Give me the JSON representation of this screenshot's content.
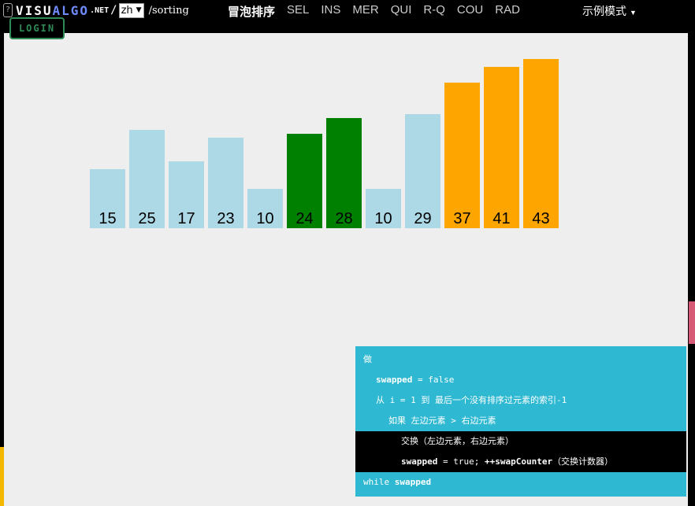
{
  "header": {
    "logo_part1": "VISU",
    "logo_part2": "ALGO",
    "logo_net": ".NET",
    "logo_slash": "/",
    "language": "zh",
    "path": "/sorting",
    "nav": [
      {
        "label": "冒泡排序",
        "active": true
      },
      {
        "label": "SEL"
      },
      {
        "label": "INS"
      },
      {
        "label": "MER"
      },
      {
        "label": "QUI"
      },
      {
        "label": "R-Q"
      },
      {
        "label": "COU"
      },
      {
        "label": "RAD"
      }
    ],
    "mode_label": "示例模式",
    "login_label": "LOGIN"
  },
  "colors": {
    "unsorted": "#add8e6",
    "compared": "#008000",
    "sorted": "#ffa500",
    "code_panel": "#2eb8d1"
  },
  "chart_data": {
    "type": "bar",
    "values": [
      15,
      25,
      17,
      23,
      10,
      24,
      28,
      10,
      29,
      37,
      41,
      43
    ],
    "states": [
      "unsorted",
      "unsorted",
      "unsorted",
      "unsorted",
      "unsorted",
      "compared",
      "compared",
      "unsorted",
      "unsorted",
      "sorted",
      "sorted",
      "sorted"
    ]
  },
  "code": {
    "lines": [
      {
        "indent": 0,
        "parts": [
          {
            "t": "做"
          }
        ]
      },
      {
        "indent": 1,
        "parts": [
          {
            "t": "swapped",
            "b": true
          },
          {
            "t": " = false"
          }
        ]
      },
      {
        "indent": 1,
        "parts": [
          {
            "t": "从 i = 1 到 最后一个没有排序过元素的索引-1"
          }
        ]
      },
      {
        "indent": 2,
        "parts": [
          {
            "t": "如果 左边元素 > 右边元素"
          }
        ]
      },
      {
        "indent": 3,
        "parts": [
          {
            "t": "交换（左边元素，右边元素）"
          }
        ],
        "highlight": true
      },
      {
        "indent": 3,
        "parts": [
          {
            "t": "swapped",
            "b": true
          },
          {
            "t": " = true; "
          },
          {
            "t": "++swapCounter",
            "b": true
          },
          {
            "t": "（交换计数器）"
          }
        ],
        "highlight": true
      },
      {
        "indent": 0,
        "parts": [
          {
            "t": "while "
          },
          {
            "t": "swapped",
            "b": true
          }
        ]
      }
    ]
  }
}
